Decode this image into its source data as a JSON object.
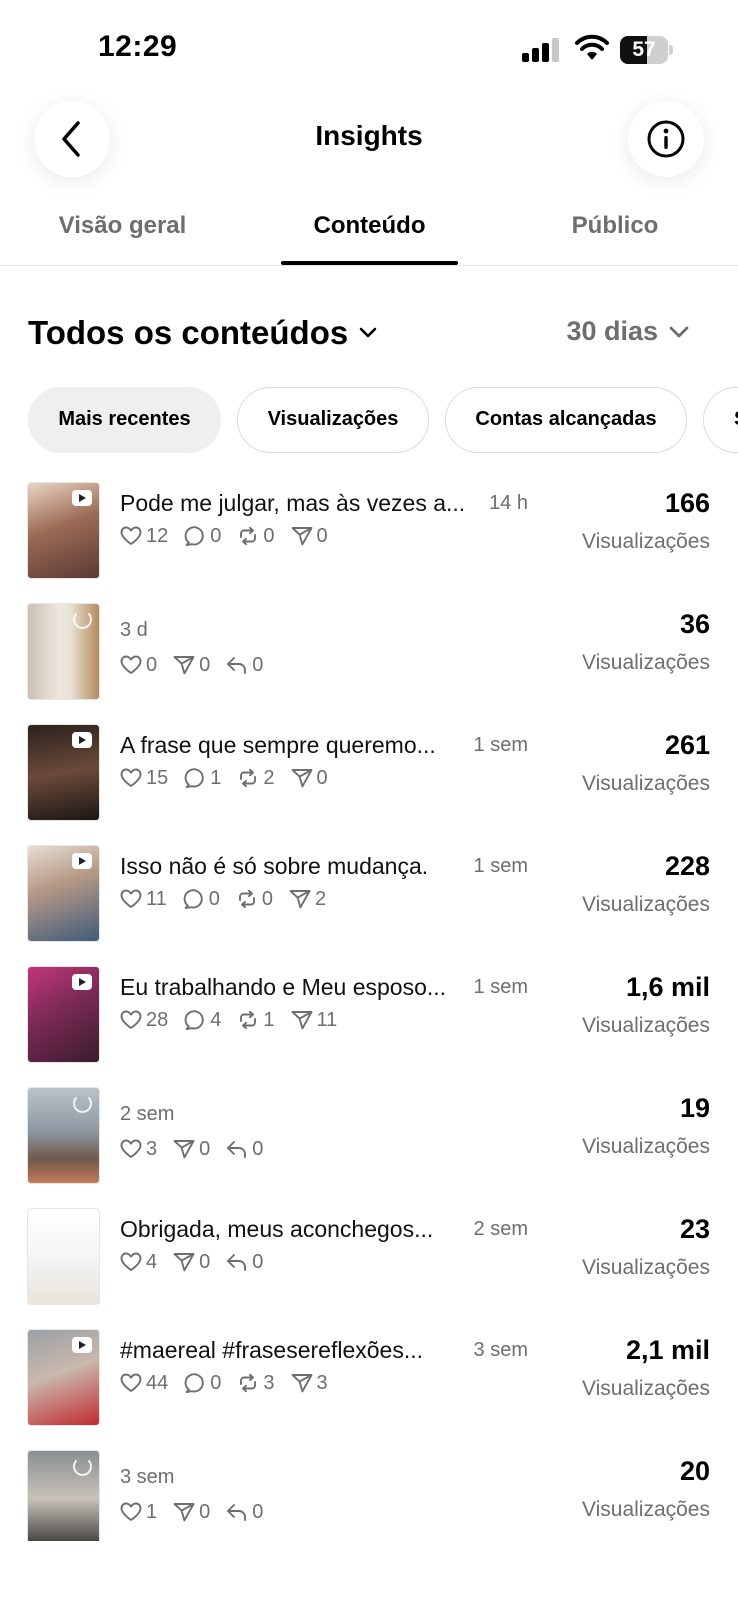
{
  "status": {
    "time": "12:29",
    "battery": 57
  },
  "header": {
    "title": "Insights"
  },
  "tabs": [
    {
      "label": "Visão geral"
    },
    {
      "label": "Conteúdo",
      "active": true
    },
    {
      "label": "Público"
    }
  ],
  "filter": {
    "title": "Todos os conteúdos",
    "period": "30 dias"
  },
  "chips": [
    {
      "label": "Mais recentes",
      "selected": true
    },
    {
      "label": "Visualizações"
    },
    {
      "label": "Contas alcançadas"
    },
    {
      "label": "S"
    }
  ],
  "items": [
    {
      "title": "Pode me julgar, mas às vezes a...",
      "time": "14 h",
      "icon": "play-icon",
      "stats": [
        {
          "icon": "heart-icon",
          "value": "12"
        },
        {
          "icon": "comment-icon",
          "value": "0"
        },
        {
          "icon": "repost-icon",
          "value": "0"
        },
        {
          "icon": "share-icon",
          "value": "0"
        }
      ],
      "value": "166",
      "label": "Visualizações"
    },
    {
      "title": "",
      "time": "3 d",
      "icon": "story-icon",
      "stats": [
        {
          "icon": "heart-icon",
          "value": "0"
        },
        {
          "icon": "share-icon",
          "value": "0"
        },
        {
          "icon": "reply-icon",
          "value": "0"
        }
      ],
      "value": "36",
      "label": "Visualizações"
    },
    {
      "title": "A frase que sempre queremo...",
      "time": "1 sem",
      "icon": "play-icon",
      "stats": [
        {
          "icon": "heart-icon",
          "value": "15"
        },
        {
          "icon": "comment-icon",
          "value": "1"
        },
        {
          "icon": "repost-icon",
          "value": "2"
        },
        {
          "icon": "share-icon",
          "value": "0"
        }
      ],
      "value": "261",
      "label": "Visualizações"
    },
    {
      "title": "Isso não é só sobre mudança.",
      "time": "1 sem",
      "icon": "play-icon",
      "stats": [
        {
          "icon": "heart-icon",
          "value": "11"
        },
        {
          "icon": "comment-icon",
          "value": "0"
        },
        {
          "icon": "repost-icon",
          "value": "0"
        },
        {
          "icon": "share-icon",
          "value": "2"
        }
      ],
      "value": "228",
      "label": "Visualizações"
    },
    {
      "title": "Eu trabalhando e Meu esposo...",
      "time": "1 sem",
      "icon": "play-icon",
      "stats": [
        {
          "icon": "heart-icon",
          "value": "28"
        },
        {
          "icon": "comment-icon",
          "value": "4"
        },
        {
          "icon": "repost-icon",
          "value": "1"
        },
        {
          "icon": "share-icon",
          "value": "11"
        }
      ],
      "value": "1,6 mil",
      "label": "Visualizações"
    },
    {
      "title": "",
      "time": "2 sem",
      "icon": "story-icon",
      "stats": [
        {
          "icon": "heart-icon",
          "value": "3"
        },
        {
          "icon": "share-icon",
          "value": "0"
        },
        {
          "icon": "reply-icon",
          "value": "0"
        }
      ],
      "value": "19",
      "label": "Visualizações"
    },
    {
      "title": "Obrigada, meus aconchegos...",
      "time": "2 sem",
      "icon": "none",
      "stats": [
        {
          "icon": "heart-icon",
          "value": "4"
        },
        {
          "icon": "share-icon",
          "value": "0"
        },
        {
          "icon": "reply-icon",
          "value": "0"
        }
      ],
      "value": "23",
      "label": "Visualizações"
    },
    {
      "title": "#maereal #frasesereflexões...",
      "time": "3 sem",
      "icon": "play-icon",
      "stats": [
        {
          "icon": "heart-icon",
          "value": "44"
        },
        {
          "icon": "comment-icon",
          "value": "0"
        },
        {
          "icon": "repost-icon",
          "value": "3"
        },
        {
          "icon": "share-icon",
          "value": "3"
        }
      ],
      "value": "2,1 mil",
      "label": "Visualizações"
    },
    {
      "title": "",
      "time": "3 sem",
      "icon": "story-icon",
      "stats": [
        {
          "icon": "heart-icon",
          "value": "1"
        },
        {
          "icon": "share-icon",
          "value": "0"
        },
        {
          "icon": "reply-icon",
          "value": "0"
        }
      ],
      "value": "20",
      "label": "Visualizações"
    }
  ]
}
